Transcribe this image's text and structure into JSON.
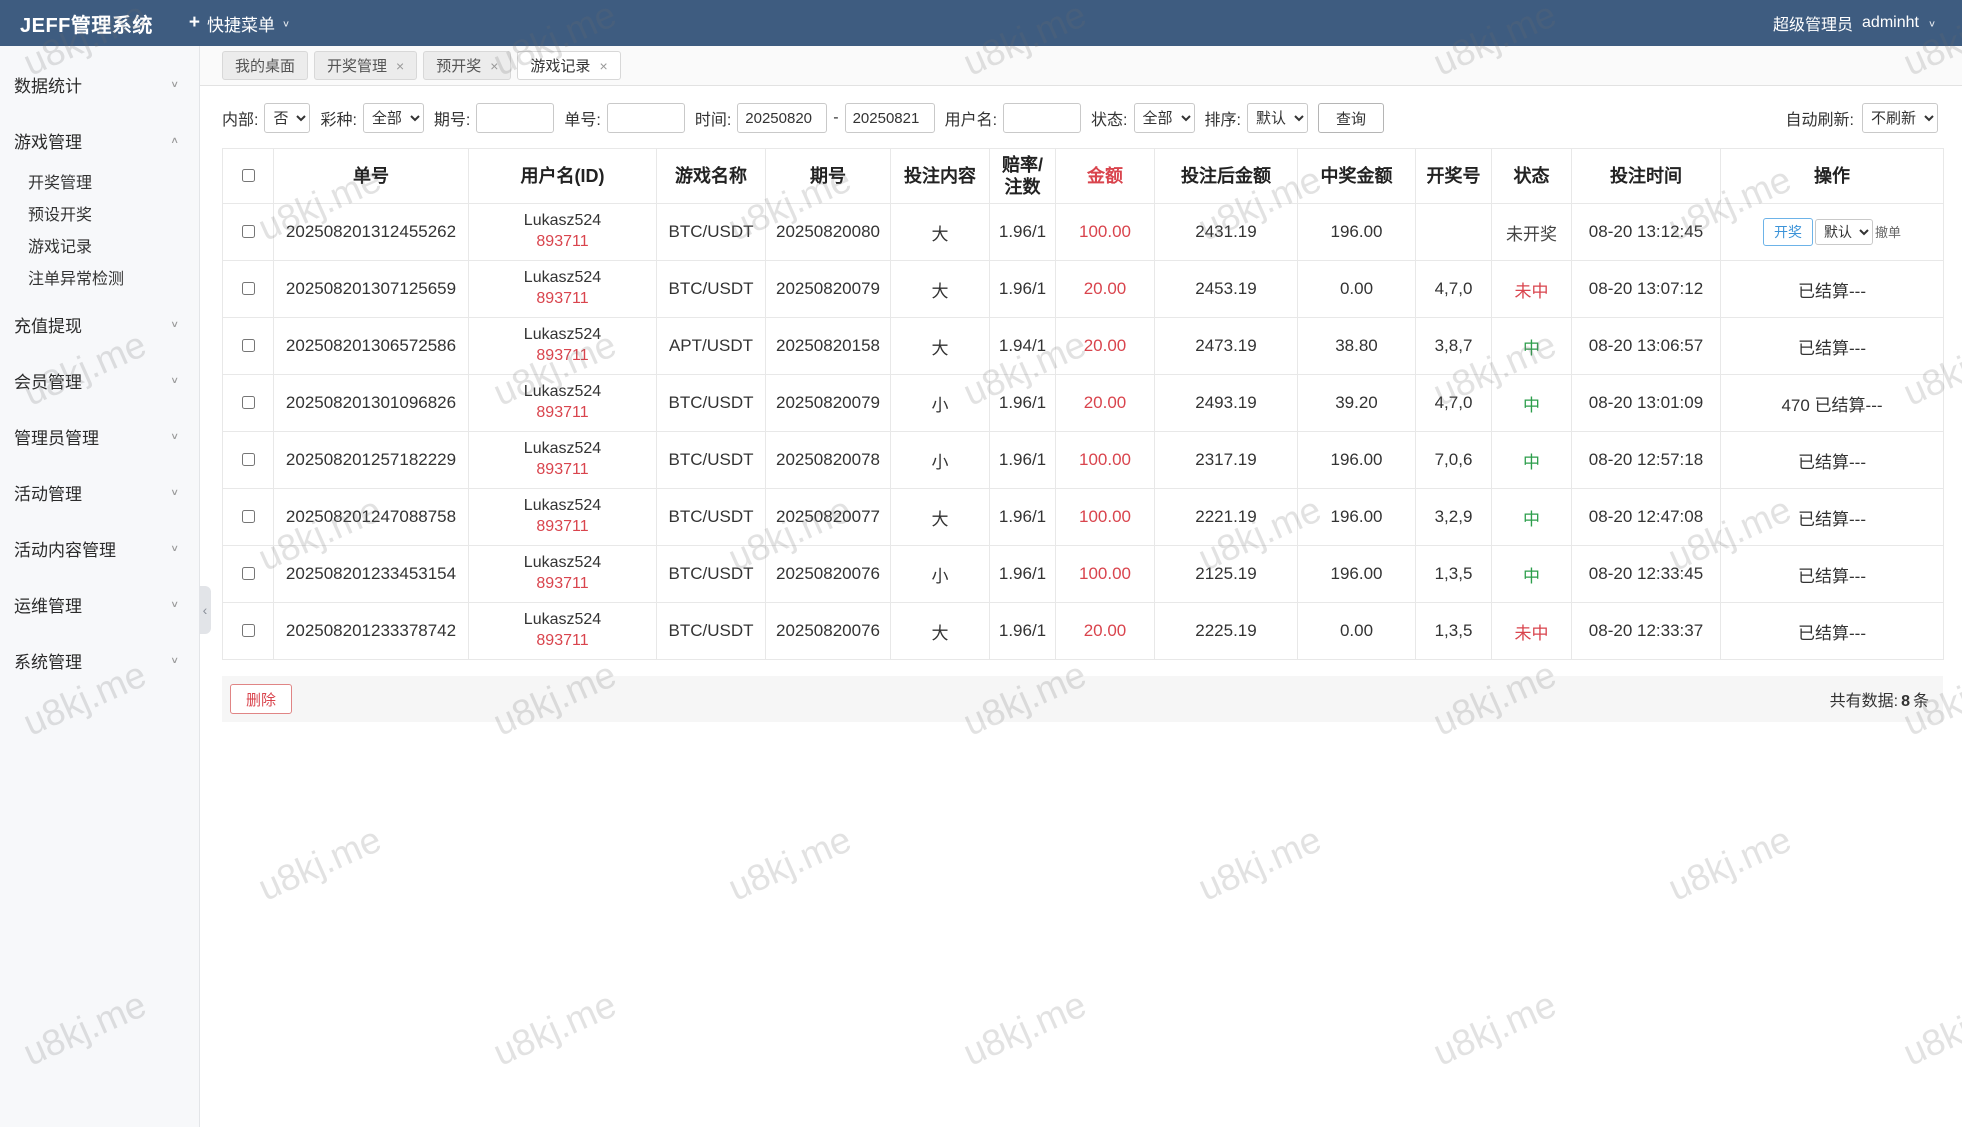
{
  "topbar": {
    "brand": "JEFF管理系统",
    "quick_menu": "快捷菜单",
    "role": "超级管理员",
    "username": "adminht"
  },
  "sidebar": {
    "active": "游戏记录",
    "collapse_icon": "‹",
    "items": [
      {
        "label": "数据统计",
        "expanded": false
      },
      {
        "label": "游戏管理",
        "expanded": true,
        "children": [
          "开奖管理",
          "预设开奖",
          "游戏记录",
          "注单异常检测"
        ]
      },
      {
        "label": "充值提现",
        "expanded": false
      },
      {
        "label": "会员管理",
        "expanded": false
      },
      {
        "label": "管理员管理",
        "expanded": false
      },
      {
        "label": "活动管理",
        "expanded": false
      },
      {
        "label": "活动内容管理",
        "expanded": false
      },
      {
        "label": "运维管理",
        "expanded": false
      },
      {
        "label": "系统管理",
        "expanded": false
      }
    ]
  },
  "tabs": [
    {
      "label": "我的桌面",
      "closable": false,
      "active": false
    },
    {
      "label": "开奖管理",
      "closable": true,
      "active": false
    },
    {
      "label": "预开奖",
      "closable": true,
      "active": false
    },
    {
      "label": "游戏记录",
      "closable": true,
      "active": true
    }
  ],
  "filters": {
    "internal_label": "内部:",
    "internal_value": "否",
    "lottery_label": "彩种:",
    "lottery_value": "全部",
    "issue_label": "期号:",
    "order_label": "单号:",
    "time_label": "时间:",
    "time_from": "20250820",
    "time_sep": "-",
    "time_to": "20250821",
    "user_label": "用户名:",
    "status_label": "状态:",
    "status_value": "全部",
    "sort_label": "排序:",
    "sort_value": "默认",
    "search_button": "查询",
    "refresh_label": "自动刷新:",
    "refresh_value": "不刷新"
  },
  "table": {
    "columns": [
      "单号",
      "用户名(ID)",
      "游戏名称",
      "期号",
      "投注内容",
      "赔率/注数",
      "金额",
      "投注后金额",
      "中奖金额",
      "开奖号",
      "状态",
      "投注时间",
      "操作"
    ],
    "action_labels": {
      "draw": "开奖",
      "select": "默认",
      "cancel": "撤单"
    },
    "rows": [
      {
        "order_no": "202508201312455262",
        "user": "Lukasz524",
        "user_id": "893711",
        "game": "BTC/USDT",
        "issue": "20250820080",
        "bet": "大",
        "odds": "1.96/1",
        "amount": "100.00",
        "after": "2431.19",
        "win": "196.00",
        "draw": "",
        "status": "未开奖",
        "status_type": "pending",
        "time": "08-20 13:12:45",
        "action": "pending"
      },
      {
        "order_no": "202508201307125659",
        "user": "Lukasz524",
        "user_id": "893711",
        "game": "BTC/USDT",
        "issue": "20250820079",
        "bet": "大",
        "odds": "1.96/1",
        "amount": "20.00",
        "after": "2453.19",
        "win": "0.00",
        "draw": "4,7,0",
        "status": "未中",
        "status_type": "lose",
        "time": "08-20 13:07:12",
        "action": "已结算---"
      },
      {
        "order_no": "202508201306572586",
        "user": "Lukasz524",
        "user_id": "893711",
        "game": "APT/USDT",
        "issue": "20250820158",
        "bet": "大",
        "odds": "1.94/1",
        "amount": "20.00",
        "after": "2473.19",
        "win": "38.80",
        "draw": "3,8,7",
        "status": "中",
        "status_type": "win",
        "time": "08-20 13:06:57",
        "action": "已结算---"
      },
      {
        "order_no": "202508201301096826",
        "user": "Lukasz524",
        "user_id": "893711",
        "game": "BTC/USDT",
        "issue": "20250820079",
        "bet": "小",
        "odds": "1.96/1",
        "amount": "20.00",
        "after": "2493.19",
        "win": "39.20",
        "draw": "4,7,0",
        "status": "中",
        "status_type": "win",
        "time": "08-20 13:01:09",
        "action": "470 已结算---"
      },
      {
        "order_no": "202508201257182229",
        "user": "Lukasz524",
        "user_id": "893711",
        "game": "BTC/USDT",
        "issue": "20250820078",
        "bet": "小",
        "odds": "1.96/1",
        "amount": "100.00",
        "after": "2317.19",
        "win": "196.00",
        "draw": "7,0,6",
        "status": "中",
        "status_type": "win",
        "time": "08-20 12:57:18",
        "action": "已结算---"
      },
      {
        "order_no": "202508201247088758",
        "user": "Lukasz524",
        "user_id": "893711",
        "game": "BTC/USDT",
        "issue": "20250820077",
        "bet": "大",
        "odds": "1.96/1",
        "amount": "100.00",
        "after": "2221.19",
        "win": "196.00",
        "draw": "3,2,9",
        "status": "中",
        "status_type": "win",
        "time": "08-20 12:47:08",
        "action": "已结算---"
      },
      {
        "order_no": "202508201233453154",
        "user": "Lukasz524",
        "user_id": "893711",
        "game": "BTC/USDT",
        "issue": "20250820076",
        "bet": "小",
        "odds": "1.96/1",
        "amount": "100.00",
        "after": "2125.19",
        "win": "196.00",
        "draw": "1,3,5",
        "status": "中",
        "status_type": "win",
        "time": "08-20 12:33:45",
        "action": "已结算---"
      },
      {
        "order_no": "202508201233378742",
        "user": "Lukasz524",
        "user_id": "893711",
        "game": "BTC/USDT",
        "issue": "20250820076",
        "bet": "大",
        "odds": "1.96/1",
        "amount": "20.00",
        "after": "2225.19",
        "win": "0.00",
        "draw": "1,3,5",
        "status": "未中",
        "status_type": "lose",
        "time": "08-20 12:33:37",
        "action": "已结算---"
      }
    ]
  },
  "footer": {
    "delete_label": "删除",
    "total_label": "共有数据:",
    "total_count": "8",
    "unit": "条"
  },
  "watermark": {
    "text": "u8kj.me"
  },
  "colors": {
    "topbar_blue": "#3e5c80",
    "amount_red": "#d9444d",
    "win_green": "#2c9e4b",
    "lose_red": "#d9444d",
    "action_blue": "#3c93d8"
  }
}
